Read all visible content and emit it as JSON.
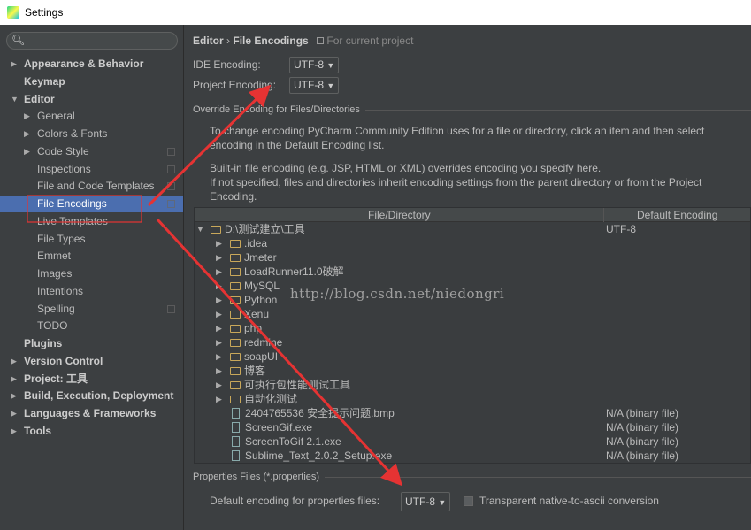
{
  "window": {
    "title": "Settings"
  },
  "search": {
    "icon": "search-icon",
    "value": ""
  },
  "sidebar": {
    "items": [
      {
        "label": "Appearance & Behavior",
        "level": 0,
        "arrow": "▶",
        "bold": true
      },
      {
        "label": "Keymap",
        "level": 0,
        "arrow": "",
        "bold": true
      },
      {
        "label": "Editor",
        "level": 0,
        "arrow": "▼",
        "bold": true
      },
      {
        "label": "General",
        "level": 1,
        "arrow": "▶"
      },
      {
        "label": "Colors & Fonts",
        "level": 1,
        "arrow": "▶"
      },
      {
        "label": "Code Style",
        "level": 1,
        "arrow": "▶",
        "project": true
      },
      {
        "label": "Inspections",
        "level": 1,
        "arrow": "",
        "project": true
      },
      {
        "label": "File and Code Templates",
        "level": 1,
        "arrow": "",
        "project": true
      },
      {
        "label": "File Encodings",
        "level": 1,
        "arrow": "",
        "project": true,
        "selected": true
      },
      {
        "label": "Live Templates",
        "level": 1,
        "arrow": ""
      },
      {
        "label": "File Types",
        "level": 1,
        "arrow": ""
      },
      {
        "label": "Emmet",
        "level": 1,
        "arrow": ""
      },
      {
        "label": "Images",
        "level": 1,
        "arrow": ""
      },
      {
        "label": "Intentions",
        "level": 1,
        "arrow": ""
      },
      {
        "label": "Spelling",
        "level": 1,
        "arrow": "",
        "project": true
      },
      {
        "label": "TODO",
        "level": 1,
        "arrow": ""
      },
      {
        "label": "Plugins",
        "level": 0,
        "arrow": "",
        "bold": true
      },
      {
        "label": "Version Control",
        "level": 0,
        "arrow": "▶",
        "bold": true
      },
      {
        "label": "Project: 工具",
        "level": 0,
        "arrow": "▶",
        "bold": true
      },
      {
        "label": "Build, Execution, Deployment",
        "level": 0,
        "arrow": "▶",
        "bold": true
      },
      {
        "label": "Languages & Frameworks",
        "level": 0,
        "arrow": "▶",
        "bold": true
      },
      {
        "label": "Tools",
        "level": 0,
        "arrow": "▶",
        "bold": true
      }
    ]
  },
  "main": {
    "breadcrumb": {
      "parent": "Editor",
      "sep": "›",
      "current": "File Encodings",
      "scope": "For current project"
    },
    "ide_encoding": {
      "label": "IDE Encoding:",
      "value": "UTF-8"
    },
    "project_encoding": {
      "label": "Project Encoding:",
      "value": "UTF-8"
    },
    "override_title": "Override Encoding for Files/Directories",
    "desc": [
      "To change encoding PyCharm Community Edition uses for a file or directory, click an item and then select encoding in the",
      "Default Encoding list.",
      "Built-in file encoding (e.g. JSP, HTML or XML) overrides encoding you specify here.",
      "If not specified, files and directories inherit encoding settings from the parent directory or from the Project Encoding."
    ],
    "table": {
      "headers": [
        "File/Directory",
        "Default Encoding"
      ],
      "rows": [
        {
          "name": "D:\\测试建立\\工具",
          "type": "folder",
          "expanded": true,
          "level": 0,
          "enc": "UTF-8"
        },
        {
          "name": ".idea",
          "type": "folder",
          "level": 1,
          "enc": ""
        },
        {
          "name": "Jmeter",
          "type": "folder",
          "level": 1,
          "enc": ""
        },
        {
          "name": "LoadRunner11.0破解",
          "type": "folder",
          "level": 1,
          "enc": ""
        },
        {
          "name": "MySQL",
          "type": "folder",
          "level": 1,
          "enc": ""
        },
        {
          "name": "Python",
          "type": "folder",
          "level": 1,
          "enc": ""
        },
        {
          "name": "Xenu",
          "type": "folder",
          "level": 1,
          "enc": ""
        },
        {
          "name": "php",
          "type": "folder",
          "level": 1,
          "enc": ""
        },
        {
          "name": "redmine",
          "type": "folder",
          "level": 1,
          "enc": ""
        },
        {
          "name": "soapUI",
          "type": "folder",
          "level": 1,
          "enc": ""
        },
        {
          "name": "博客",
          "type": "folder",
          "level": 1,
          "enc": ""
        },
        {
          "name": "可执行包性能测试工具",
          "type": "folder",
          "level": 1,
          "enc": ""
        },
        {
          "name": "自动化测试",
          "type": "folder",
          "level": 1,
          "enc": ""
        },
        {
          "name": "2404765536 安全提示问题.bmp",
          "type": "file",
          "level": 1,
          "enc": "N/A (binary file)"
        },
        {
          "name": "ScreenGif.exe",
          "type": "file",
          "level": 1,
          "enc": "N/A (binary file)"
        },
        {
          "name": "ScreenToGif 2.1.exe",
          "type": "file",
          "level": 1,
          "enc": "N/A (binary file)"
        },
        {
          "name": "Sublime_Text_2.0.2_Setup.exe",
          "type": "file",
          "level": 1,
          "enc": "N/A (binary file)"
        }
      ]
    },
    "properties": {
      "title": "Properties Files (*.properties)",
      "label": "Default encoding for properties files:",
      "value": "UTF-8",
      "checkbox_label": "Transparent native-to-ascii conversion",
      "checked": false
    }
  },
  "watermark": "http://blog.csdn.net/niedongri",
  "colors": {
    "background": "#3c3f41",
    "selection": "#4b6eaf",
    "annotation": "#e53333"
  }
}
